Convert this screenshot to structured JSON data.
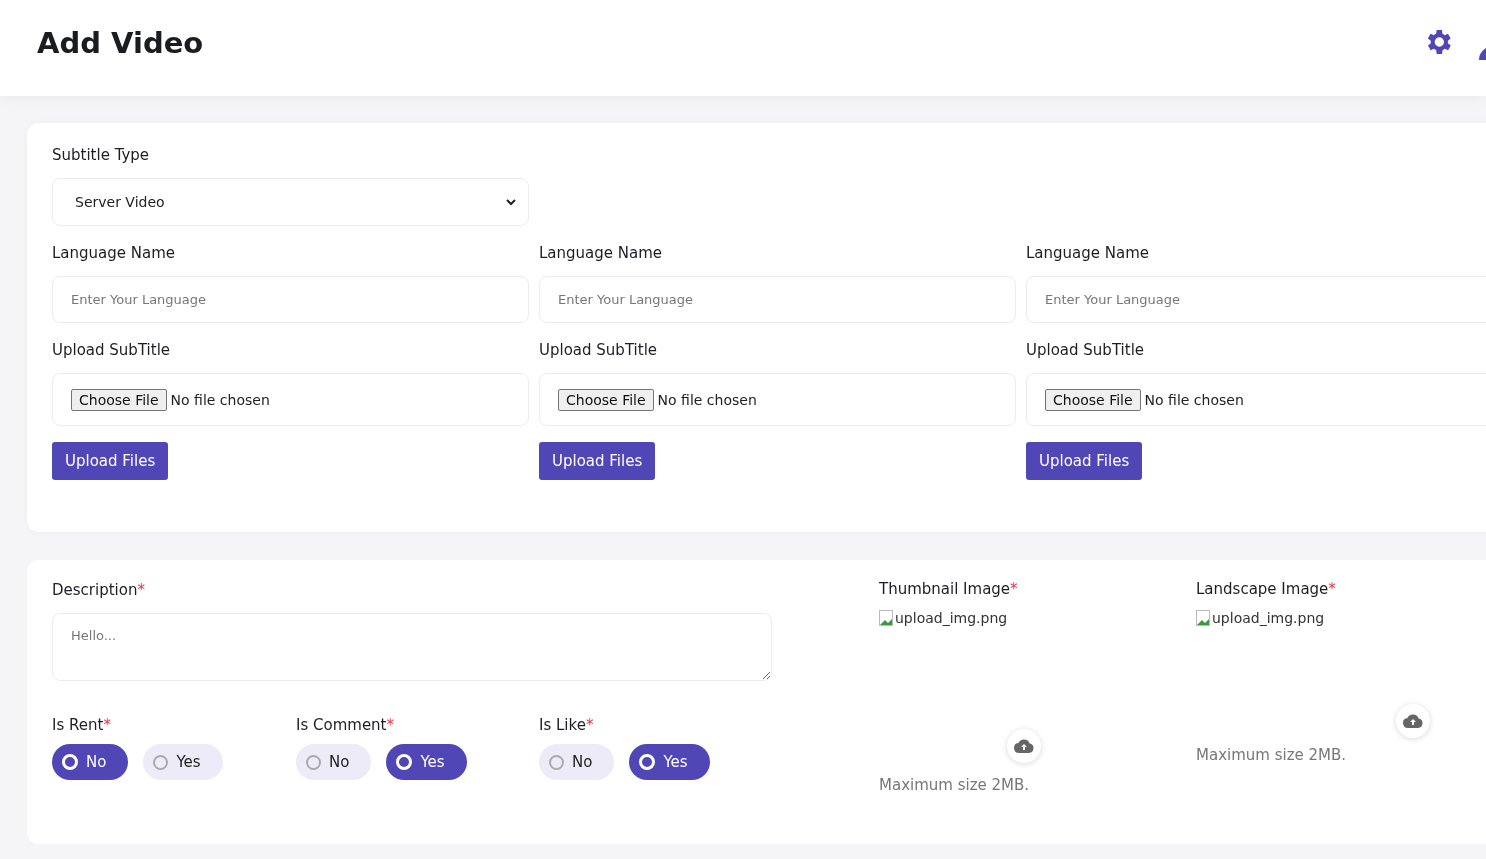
{
  "header": {
    "title": "Add Video"
  },
  "subtitle_form": {
    "subtitle_type": {
      "label": "Subtitle Type",
      "value": "Server Video"
    },
    "columns": [
      {
        "language_label": "Language Name",
        "language_placeholder": "Enter Your Language",
        "upload_label": "Upload SubTitle",
        "choose_button": "Choose File",
        "file_status": "No file chosen",
        "submit_button": "Upload Files"
      },
      {
        "language_label": "Language Name",
        "language_placeholder": "Enter Your Language",
        "upload_label": "Upload SubTitle",
        "choose_button": "Choose File",
        "file_status": "No file chosen",
        "submit_button": "Upload Files"
      },
      {
        "language_label": "Language Name",
        "language_placeholder": "Enter Your Language",
        "upload_label": "Upload SubTitle",
        "choose_button": "Choose File",
        "file_status": "No file chosen",
        "submit_button": "Upload Files"
      }
    ]
  },
  "details_form": {
    "description": {
      "label": "Description",
      "required_mark": "*",
      "placeholder": "Hello..."
    },
    "toggles": [
      {
        "label": "Is Rent",
        "required_mark": "*",
        "options": [
          {
            "label": "No",
            "selected": true
          },
          {
            "label": "Yes",
            "selected": false
          }
        ]
      },
      {
        "label": "Is Comment",
        "required_mark": "*",
        "options": [
          {
            "label": "No",
            "selected": false
          },
          {
            "label": "Yes",
            "selected": true
          }
        ]
      },
      {
        "label": "Is Like",
        "required_mark": "*",
        "options": [
          {
            "label": "No",
            "selected": false
          },
          {
            "label": "Yes",
            "selected": true
          }
        ]
      }
    ],
    "images": [
      {
        "label": "Thumbnail Image",
        "required_mark": "*",
        "alt_text": "upload_img.png",
        "hint": "Maximum size 2MB."
      },
      {
        "label": "Landscape Image",
        "required_mark": "*",
        "alt_text": "upload_img.png",
        "hint": "Maximum size 2MB."
      }
    ]
  }
}
